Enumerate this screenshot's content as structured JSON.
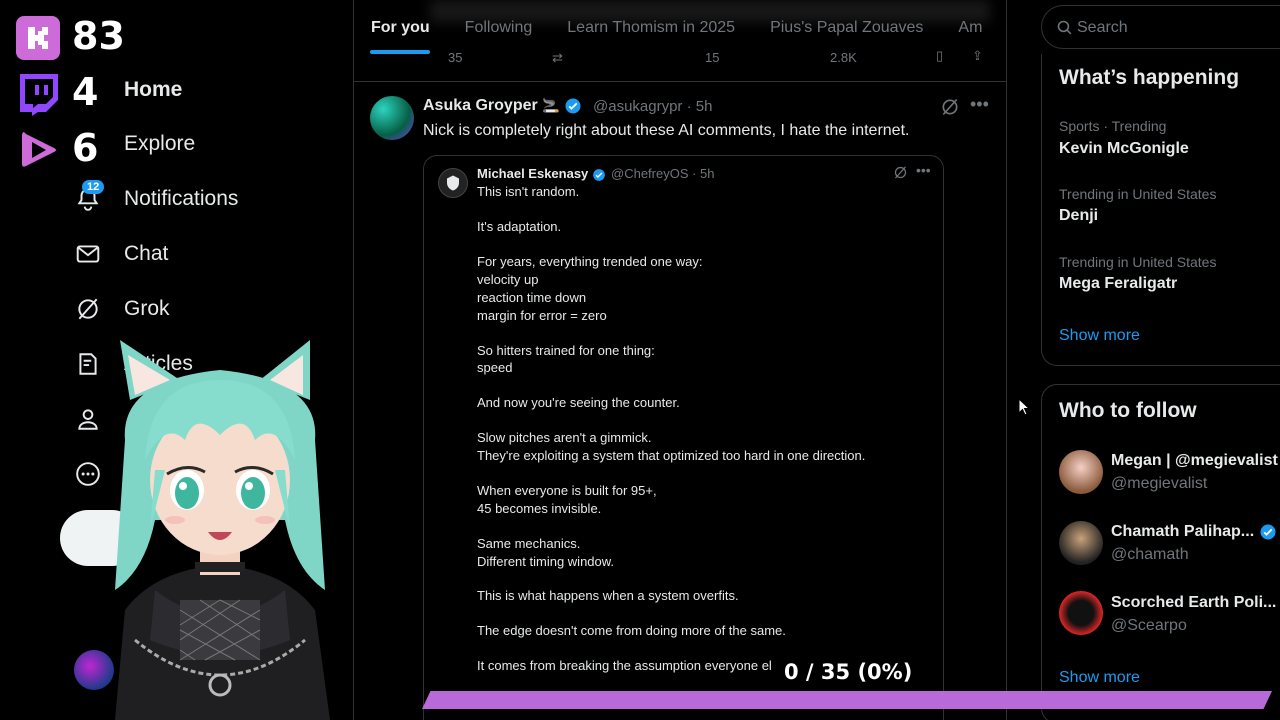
{
  "overlay": {
    "kick_count": "83",
    "twitch_count": "4",
    "other_count": "6",
    "progress_text": "0 / 35 (0%)",
    "progress_fraction": 0
  },
  "nav": {
    "home": "Home",
    "explore": "Explore",
    "notifications": "Notifications",
    "notifications_badge": "12",
    "chat": "Chat",
    "grok": "Grok",
    "articles": "Articles"
  },
  "tabs": [
    "For you",
    "Following",
    "Learn Thomism in 2025",
    "Pius's Papal Zouaves",
    "Am"
  ],
  "prev_post_actions": {
    "replies": "35",
    "likes": "15",
    "views": "2.8K"
  },
  "post": {
    "author": "Asuka Groyper",
    "author_emoji": "🚬",
    "handle_time": "@asukagrypr · 5h",
    "text": "Nick is completely right about these AI comments, I hate the internet."
  },
  "quote": {
    "author": "Michael Eskenasy",
    "handle_time": "@ChefreyOS · 5h",
    "lines": [
      "This isn't random.",
      "It's adaptation.",
      "For years, everything trended one way:",
      "velocity up",
      "reaction time down",
      "margin for error = zero",
      "So hitters trained for one thing:",
      "speed",
      "And now you're seeing the counter.",
      "Slow pitches aren't a gimmick.",
      "They're exploiting a system that optimized too hard in one direction.",
      "When everyone is built for 95+,",
      "45 becomes invisible.",
      "Same mechanics.",
      "Different timing window.",
      "This is what happens when a system overfits.",
      "The edge doesn't come from doing more of the same.",
      "It comes from breaking the assumption everyone el"
    ]
  },
  "search": {
    "placeholder": "Search"
  },
  "whats_happening": {
    "title": "What’s happening",
    "trends": [
      {
        "meta": "Sports · Trending",
        "name": "Kevin McGonigle"
      },
      {
        "meta": "Trending in United States",
        "name": "Denji"
      },
      {
        "meta": "Trending in United States",
        "name": "Mega Feraligatr"
      }
    ],
    "show_more": "Show more"
  },
  "who_to_follow": {
    "title": "Who to follow",
    "accounts": [
      {
        "name": "Megan | @megievalist",
        "handle": "@megievalist"
      },
      {
        "name": "Chamath Palihap...",
        "handle": "@chamath"
      },
      {
        "name": "Scorched Earth Poli...",
        "handle": "@Scearpo"
      }
    ],
    "show_more": "Show more"
  },
  "colors": {
    "accent": "#1d9bf0",
    "kick": "#cd6bd9",
    "twitch": "#9146ff",
    "progress": "#b86ad8"
  }
}
